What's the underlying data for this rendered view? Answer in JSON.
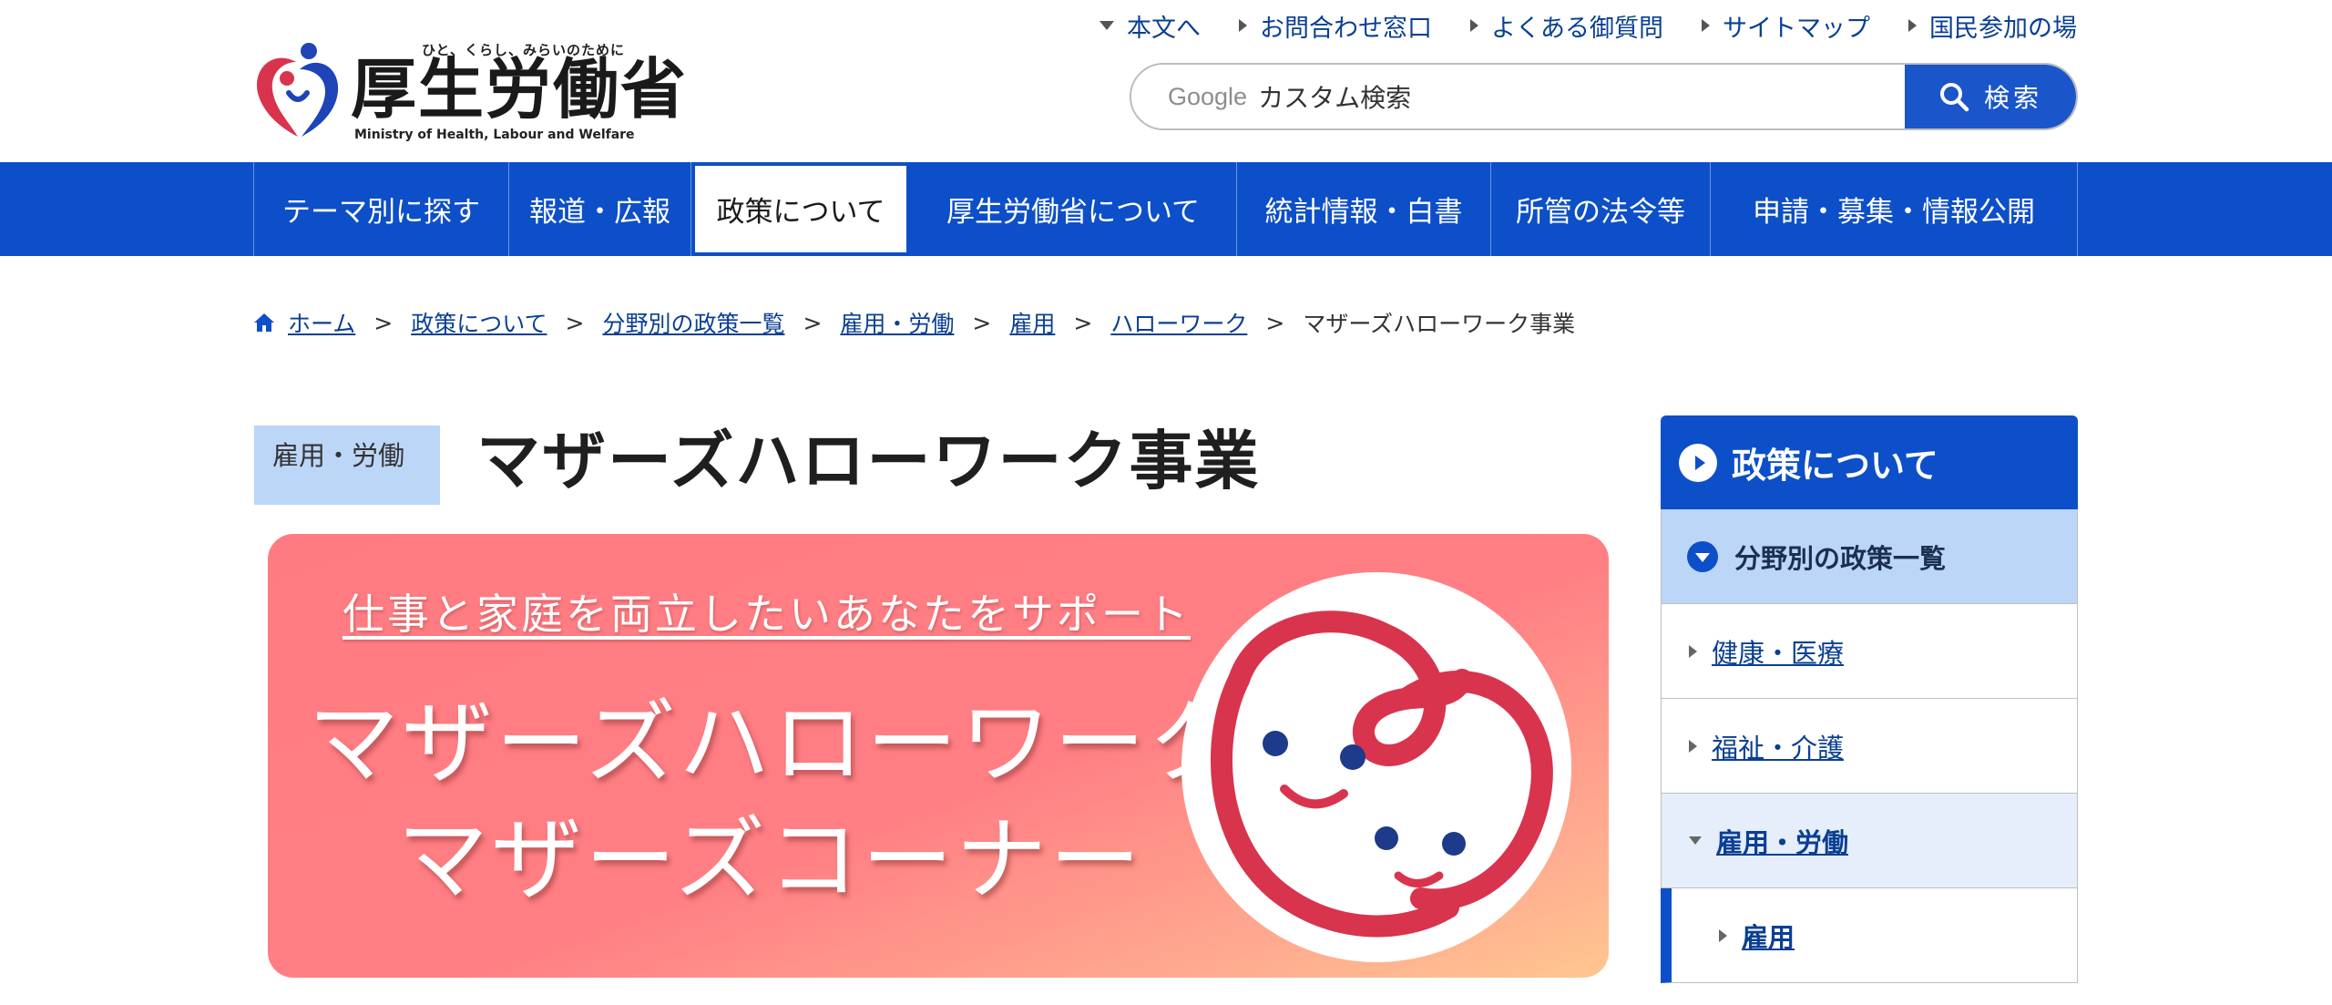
{
  "logo": {
    "tagline": "ひと、くらし、みらいのために",
    "name": "厚生労働省",
    "english": "Ministry of Health, Labour and Welfare"
  },
  "utility_links": [
    {
      "label": "本文へ",
      "icon": "triangle-down-icon"
    },
    {
      "label": "お問合わせ窓口",
      "icon": "triangle-right-icon"
    },
    {
      "label": "よくある御質問",
      "icon": "triangle-right-icon"
    },
    {
      "label": "サイトマップ",
      "icon": "triangle-right-icon"
    },
    {
      "label": "国民参加の場",
      "icon": "triangle-right-icon"
    }
  ],
  "search": {
    "brand": "Google",
    "placeholder": "カスタム検索",
    "button_label": "検索"
  },
  "nav": [
    {
      "label": "テーマ別に探す",
      "active": false
    },
    {
      "label": "報道・広報",
      "active": false
    },
    {
      "label": "政策について",
      "active": true
    },
    {
      "label": "厚生労働省について",
      "active": false
    },
    {
      "label": "統計情報・白書",
      "active": false
    },
    {
      "label": "所管の法令等",
      "active": false
    },
    {
      "label": "申請・募集・情報公開",
      "active": false
    }
  ],
  "breadcrumb": {
    "items": [
      "ホーム",
      "政策について",
      "分野別の政策一覧",
      "雇用・労働",
      "雇用",
      "ハローワーク"
    ],
    "separator": ">",
    "current": "マザーズハローワーク事業"
  },
  "page": {
    "category": "雇用・労働",
    "title": "マザーズハローワーク事業"
  },
  "banner": {
    "lead": "仕事と家庭を両立したいあなたをサポート",
    "title_line1": "マザーズハローワーク",
    "title_line2": "マザーズコーナー"
  },
  "sidebar": {
    "heading": "政策について",
    "subheading": "分野別の政策一覧",
    "items": [
      {
        "label": "健康・医療"
      },
      {
        "label": "福祉・介護"
      },
      {
        "label": "雇用・労働"
      },
      {
        "label": "雇用"
      }
    ]
  },
  "colors": {
    "primary_blue": "#0d4fc8",
    "link_blue": "#0a3f93",
    "light_blue": "#bcd6f7",
    "banner_pink": "#ff7b82",
    "logo_red": "#d8344e"
  }
}
